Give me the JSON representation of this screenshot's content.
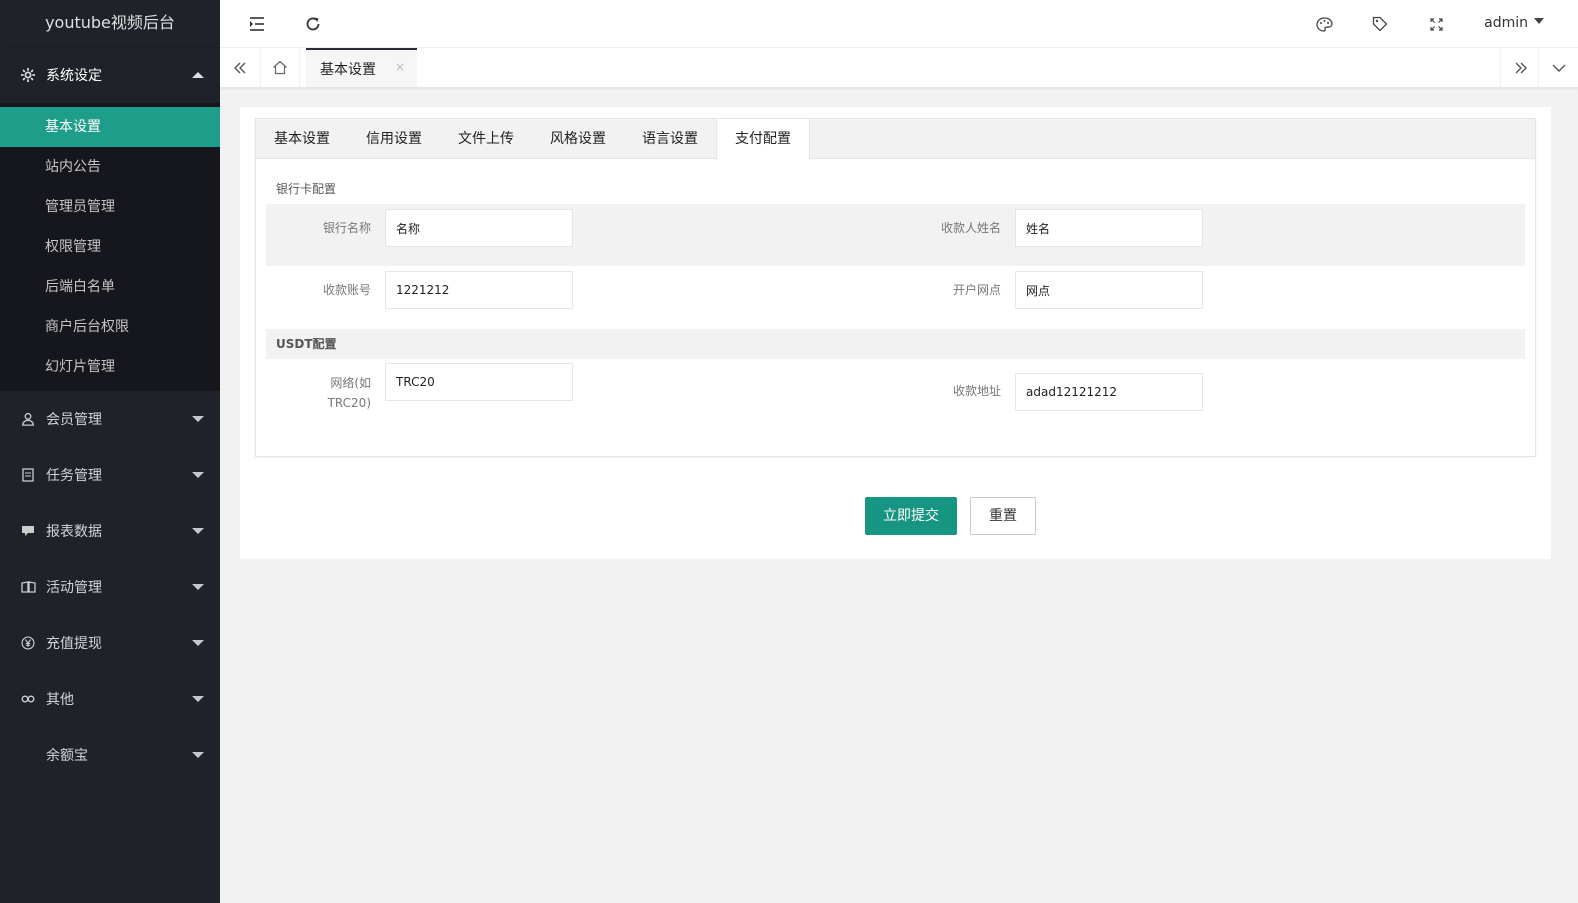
{
  "app": {
    "title": "youtube视频后台"
  },
  "sidebar": {
    "groups": [
      {
        "label": "系统设定",
        "icon": "gear-icon",
        "open": true,
        "items": [
          "基本设置",
          "站内公告",
          "管理员管理",
          "权限管理",
          "后端白名单",
          "商户后台权限",
          "幻灯片管理"
        ]
      },
      {
        "label": "会员管理",
        "icon": "user-icon"
      },
      {
        "label": "任务管理",
        "icon": "document-icon"
      },
      {
        "label": "报表数据",
        "icon": "chat-icon"
      },
      {
        "label": "活动管理",
        "icon": "book-icon"
      },
      {
        "label": "充值提现",
        "icon": "yen-icon"
      },
      {
        "label": "其他",
        "icon": "link-icon"
      },
      {
        "label": "余额宝",
        "icon": ""
      }
    ]
  },
  "header": {
    "user": "admin"
  },
  "tabbar": {
    "home_icon": "home-icon",
    "active_tab": "基本设置",
    "close": "×"
  },
  "form": {
    "tabs": [
      "基本设置",
      "信用设置",
      "文件上传",
      "风格设置",
      "语言设置",
      "支付配置"
    ],
    "active_tab": "支付配置",
    "bank_section": "银行卡配置",
    "bank_name_label": "银行名称",
    "bank_name_value": "名称",
    "payee_name_label": "收款人姓名",
    "payee_name_value": "姓名",
    "account_label": "收款账号",
    "account_value": "1221212",
    "branch_label": "开户网点",
    "branch_value": "网点",
    "usdt_section": "USDT配置",
    "network_label": "网络(如TRC20)",
    "network_value": "TRC20",
    "address_label": "收款地址",
    "address_value": "adad12121212",
    "submit": "立即提交",
    "reset": "重置"
  },
  "colors": {
    "sidebar_bg": "#20222a",
    "accent": "#169582",
    "active_item": "#1e9e8a"
  }
}
